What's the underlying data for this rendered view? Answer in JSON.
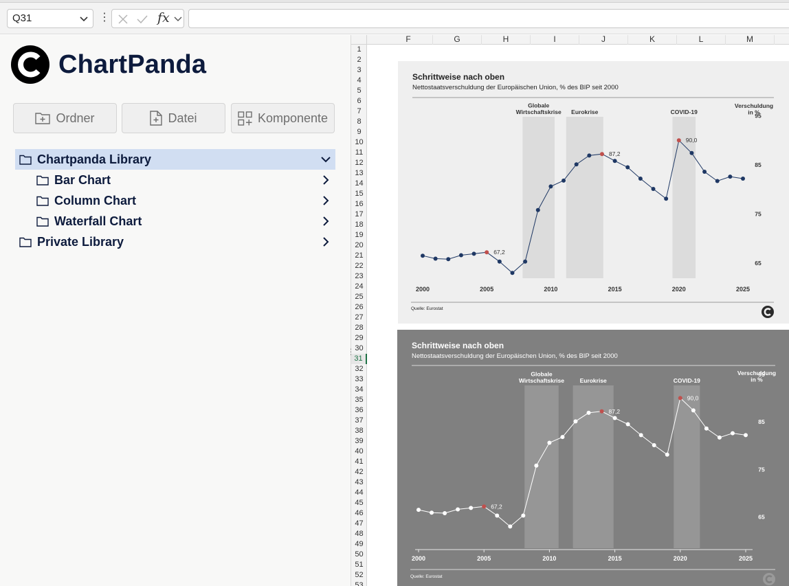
{
  "formula_bar": {
    "name_box": "Q31",
    "fx_label": "fx",
    "formula": ""
  },
  "panel": {
    "brand": "ChartPanda",
    "buttons": {
      "folder": "Ordner",
      "file": "Datei",
      "component": "Komponente"
    },
    "tree": [
      {
        "label": "Chartpanda Library",
        "level": 0,
        "expanded": true,
        "selected": true
      },
      {
        "label": "Bar Chart",
        "level": 1,
        "expanded": false
      },
      {
        "label": "Column Chart",
        "level": 1,
        "expanded": false
      },
      {
        "label": "Waterfall Chart",
        "level": 1,
        "expanded": false
      },
      {
        "label": "Private Library",
        "level": 0,
        "expanded": false
      }
    ]
  },
  "sheet": {
    "columns": [
      "F",
      "G",
      "H",
      "I",
      "J",
      "K",
      "L",
      "M"
    ],
    "first_row": 1,
    "last_row": 53,
    "active_row": 31
  },
  "colors": {
    "accent_navy": "#0d1b3d",
    "selection": "#d1def2",
    "highlight_point": "#c0504d",
    "line_light_chart": "#1f3864",
    "dark_chart_bg": "#808080"
  },
  "chart_data": [
    {
      "type": "line",
      "title": "Schrittweise nach oben",
      "subtitle": "Nettostaatsverschuldung der Europäischen Union, % des BIP seit 2000",
      "ylabel": "Verschuldung in %",
      "ylabel_lines": [
        "Verschuldung",
        "in %"
      ],
      "source": "Quelle: Eurostat",
      "x": [
        2000,
        2001,
        2002,
        2003,
        2004,
        2005,
        2006,
        2007,
        2008,
        2009,
        2010,
        2011,
        2012,
        2013,
        2014,
        2015,
        2016,
        2017,
        2018,
        2019,
        2020,
        2021,
        2022,
        2023,
        2024,
        2025
      ],
      "values": [
        66.5,
        65.9,
        65.8,
        66.6,
        66.9,
        67.2,
        65.3,
        63.0,
        65.3,
        75.8,
        80.6,
        81.8,
        85.1,
        86.9,
        87.2,
        85.8,
        84.5,
        82.2,
        80.1,
        78.1,
        90.0,
        87.4,
        83.6,
        81.7,
        82.6,
        82.2
      ],
      "highlight": [
        {
          "x": 2005,
          "label": "67,2"
        },
        {
          "x": 2014,
          "label": "87,2"
        },
        {
          "x": 2020,
          "label": "90,0"
        }
      ],
      "bands": [
        {
          "label_lines": [
            "Globale",
            "Wirtschaftskrise"
          ],
          "from": 2007.8,
          "to": 2010.3
        },
        {
          "label_lines": [
            "Eurokrise"
          ],
          "from": 2011.2,
          "to": 2014.1
        },
        {
          "label_lines": [
            "COVID-19"
          ],
          "from": 2019.5,
          "to": 2021.3
        }
      ],
      "x_ticks": [
        "2000",
        "2005",
        "2010",
        "2015",
        "2020",
        "2025"
      ],
      "y_ticks": [
        "95",
        "85",
        "75",
        "65"
      ],
      "ylim": [
        58,
        98
      ],
      "legend": "none",
      "grid": false
    },
    {
      "type": "line",
      "title": "Schrittweise nach oben",
      "subtitle": "Nettostaatsverschuldung der Europäischen Union, % des BIP seit 2000",
      "ylabel": "Verschuldung in %",
      "ylabel_lines": [
        "Verschuldung",
        "in %"
      ],
      "source": "Quelle: Eurostat",
      "x": [
        2000,
        2001,
        2002,
        2003,
        2004,
        2005,
        2006,
        2007,
        2008,
        2009,
        2010,
        2011,
        2012,
        2013,
        2014,
        2015,
        2016,
        2017,
        2018,
        2019,
        2020,
        2021,
        2022,
        2023,
        2024,
        2025
      ],
      "values": [
        66.5,
        65.9,
        65.8,
        66.6,
        66.9,
        67.2,
        65.3,
        63.0,
        65.3,
        75.8,
        80.6,
        81.8,
        85.1,
        86.9,
        87.2,
        85.8,
        84.5,
        82.2,
        80.1,
        78.1,
        90.0,
        87.4,
        83.6,
        81.7,
        82.6,
        82.2
      ],
      "highlight": [
        {
          "x": 2005,
          "label": "67,2"
        },
        {
          "x": 2014,
          "label": "87,2"
        },
        {
          "x": 2020,
          "label": "90,0"
        }
      ],
      "bands": [
        {
          "label_lines": [
            "Globale",
            "Wirtschaftskrise"
          ],
          "from": 2008.1,
          "to": 2010.7
        },
        {
          "label_lines": [
            "Eurokrise"
          ],
          "from": 2011.8,
          "to": 2014.9
        },
        {
          "label_lines": [
            "COVID-19"
          ],
          "from": 2019.5,
          "to": 2021.5
        }
      ],
      "x_ticks": [
        "2000",
        "2005",
        "2010",
        "2015",
        "2020",
        "2025"
      ],
      "y_ticks": [
        "95",
        "85",
        "75",
        "65"
      ],
      "ylim": [
        58,
        98
      ],
      "legend": "none",
      "grid": false
    }
  ]
}
